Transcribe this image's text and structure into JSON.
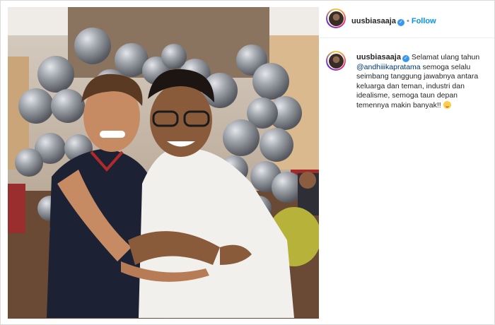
{
  "post": {
    "username": "uusbiasaaja",
    "follow_label": "Follow",
    "separator": "•",
    "caption_text": "Selamat ulang tahun",
    "caption_mention": "@andhiiikapratama",
    "caption_rest": "semoga selalu seimbang tanggung jawabnya antara keluarga dan teman, industri dan idealisme, semoga taun depan temennya makin banyak!!",
    "emoji": "blushing-smile"
  },
  "icons": {
    "verified": "verified-badge-icon",
    "verified_glyph": "✓"
  },
  "colors": {
    "accent": "#0095f6",
    "mention": "#00376b",
    "verified": "#3897f0"
  }
}
